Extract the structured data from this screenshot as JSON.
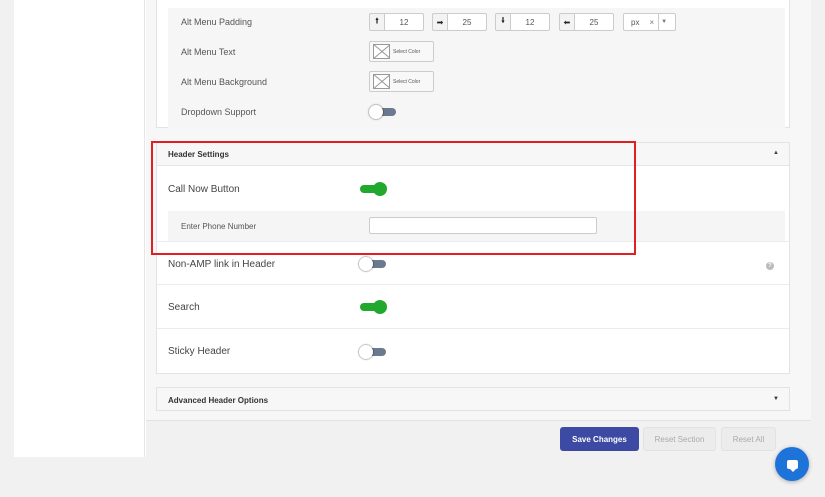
{
  "alt_menu": {
    "padding_label": "Alt Menu Padding",
    "padding": [
      {
        "icon": "arrow-up-icon",
        "glyph": "🠙",
        "value": "12"
      },
      {
        "icon": "arrow-right-icon",
        "glyph": "➡",
        "value": "25"
      },
      {
        "icon": "arrow-down-icon",
        "glyph": "🠛",
        "value": "12"
      },
      {
        "icon": "arrow-left-icon",
        "glyph": "⬅",
        "value": "25"
      }
    ],
    "unit": "px",
    "unit_clear": "×",
    "unit_arrow": "▼",
    "text_label": "Alt Menu Text",
    "background_label": "Alt Menu Background",
    "select_color": "Select Color",
    "dropdown_label": "Dropdown Support",
    "dropdown_on": false
  },
  "header_settings": {
    "title": "Header Settings",
    "caret": "▲",
    "call_now_label": "Call Now Button",
    "call_now_on": true,
    "phone_label": "Enter Phone Number",
    "phone_value": "",
    "non_amp_label": "Non-AMP link in Header",
    "non_amp_on": false,
    "help": "?",
    "search_label": "Search",
    "search_on": true,
    "sticky_label": "Sticky Header",
    "sticky_on": false
  },
  "advanced": {
    "title": "Advanced Header Options",
    "caret": "▼"
  },
  "footer": {
    "save": "Save Changes",
    "reset_section": "Reset Section",
    "reset_all": "Reset All"
  },
  "colors": {
    "toggle_on": "#22a82c",
    "toggle_off": "#6b7a8f",
    "save_button": "#3d4aa3",
    "chat": "#1e73d8",
    "highlight": "#e02020"
  }
}
